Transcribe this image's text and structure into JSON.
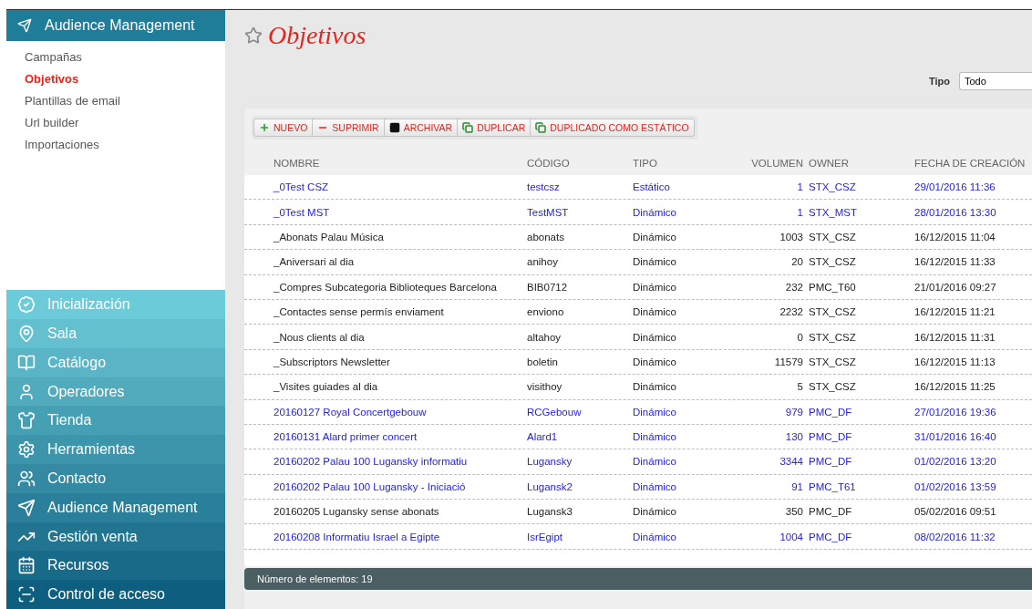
{
  "sidebar": {
    "section": {
      "title": "Audience Management",
      "items": [
        {
          "label": "Campañas",
          "selected": false
        },
        {
          "label": "Objetivos",
          "selected": true
        },
        {
          "label": "Plantillas de email",
          "selected": false
        },
        {
          "label": "Url builder",
          "selected": false
        },
        {
          "label": "Importaciones",
          "selected": false
        }
      ]
    },
    "modules": [
      "Inicialización",
      "Sala",
      "Catálogo",
      "Operadores",
      "Tienda",
      "Herramientas",
      "Contacto",
      "Audience Management",
      "Gestión venta",
      "Recursos",
      "Control de acceso"
    ]
  },
  "page": {
    "title": "Objetivos",
    "favorite": false
  },
  "filter": {
    "label": "Tipo",
    "value": "Todo"
  },
  "toolbar": [
    "NUEVO",
    "SUPRIMIR",
    "ARCHIVAR",
    "DUPLICAR",
    "DUPLICADO COMO ESTÁTICO"
  ],
  "table": {
    "columns": [
      "NOMBRE",
      "CÓDIGO",
      "TIPO",
      "VOLUMEN",
      "OWNER",
      "FECHA DE CREACIÓN"
    ],
    "rows": [
      {
        "linked": true,
        "cells": [
          "_0Test CSZ",
          "testcsz",
          "Estático",
          "1",
          "STX_CSZ",
          "29/01/2016 11:36"
        ]
      },
      {
        "linked": true,
        "cells": [
          "_0Test MST",
          "TestMST",
          "Dinámico",
          "1",
          "STX_MST",
          "28/01/2016 13:30"
        ]
      },
      {
        "linked": false,
        "cells": [
          "_Abonats Palau Música",
          "abonats",
          "Dinámico",
          "1003",
          "STX_CSZ",
          "16/12/2015 11:04"
        ]
      },
      {
        "linked": false,
        "cells": [
          "_Aniversari al dia",
          "anihoy",
          "Dinámico",
          "20",
          "STX_CSZ",
          "16/12/2015 11:33"
        ]
      },
      {
        "linked": false,
        "cells": [
          "_Compres Subcategoria Biblioteques Barcelona",
          "BIB0712",
          "Dinámico",
          "232",
          "PMC_T60",
          "21/01/2016 09:27"
        ]
      },
      {
        "linked": false,
        "cells": [
          "_Contactes sense permís enviament",
          "enviono",
          "Dinámico",
          "2232",
          "STX_CSZ",
          "16/12/2015 11:21"
        ]
      },
      {
        "linked": false,
        "cells": [
          "_Nous clients al dia",
          "altahoy",
          "Dinámico",
          "0",
          "STX_CSZ",
          "16/12/2015 11:31"
        ]
      },
      {
        "linked": false,
        "cells": [
          "_Subscriptors Newsletter",
          "boletin",
          "Dinámico",
          "11579",
          "STX_CSZ",
          "16/12/2015 11:13"
        ]
      },
      {
        "linked": false,
        "cells": [
          "_Visites guiades al dia",
          "visithoy",
          "Dinámico",
          "5",
          "STX_CSZ",
          "16/12/2015 11:25"
        ]
      },
      {
        "linked": true,
        "cells": [
          "20160127 Royal Concertgebouw",
          "RCGebouw",
          "Dinámico",
          "979",
          "PMC_DF",
          "27/01/2016 19:36"
        ]
      },
      {
        "linked": true,
        "cells": [
          "20160131 Alard primer concert",
          "Alard1",
          "Dinámico",
          "130",
          "PMC_DF",
          "31/01/2016 16:40"
        ]
      },
      {
        "linked": true,
        "cells": [
          "20160202 Palau 100 Lugansky informatiu",
          "Lugansky",
          "Dinámico",
          "3344",
          "PMC_DF",
          "01/02/2016 13:20"
        ]
      },
      {
        "linked": true,
        "cells": [
          "20160202 Palau 100 Lugansky - Iniciació",
          "Lugansk2",
          "Dinámico",
          "91",
          "PMC_T61",
          "01/02/2016 13:59"
        ]
      },
      {
        "linked": false,
        "cells": [
          "20160205 Lugansky sense abonats",
          "Lugansk3",
          "Dinámico",
          "350",
          "PMC_DF",
          "05/02/2016 09:51"
        ]
      },
      {
        "linked": true,
        "cells": [
          "20160208 Informatiu Israel a Egipte",
          "IsrEgipt",
          "Dinámico",
          "1004",
          "PMC_DF",
          "08/02/2016 11:32"
        ]
      }
    ]
  },
  "status_bar": "Número de elementos: 19"
}
